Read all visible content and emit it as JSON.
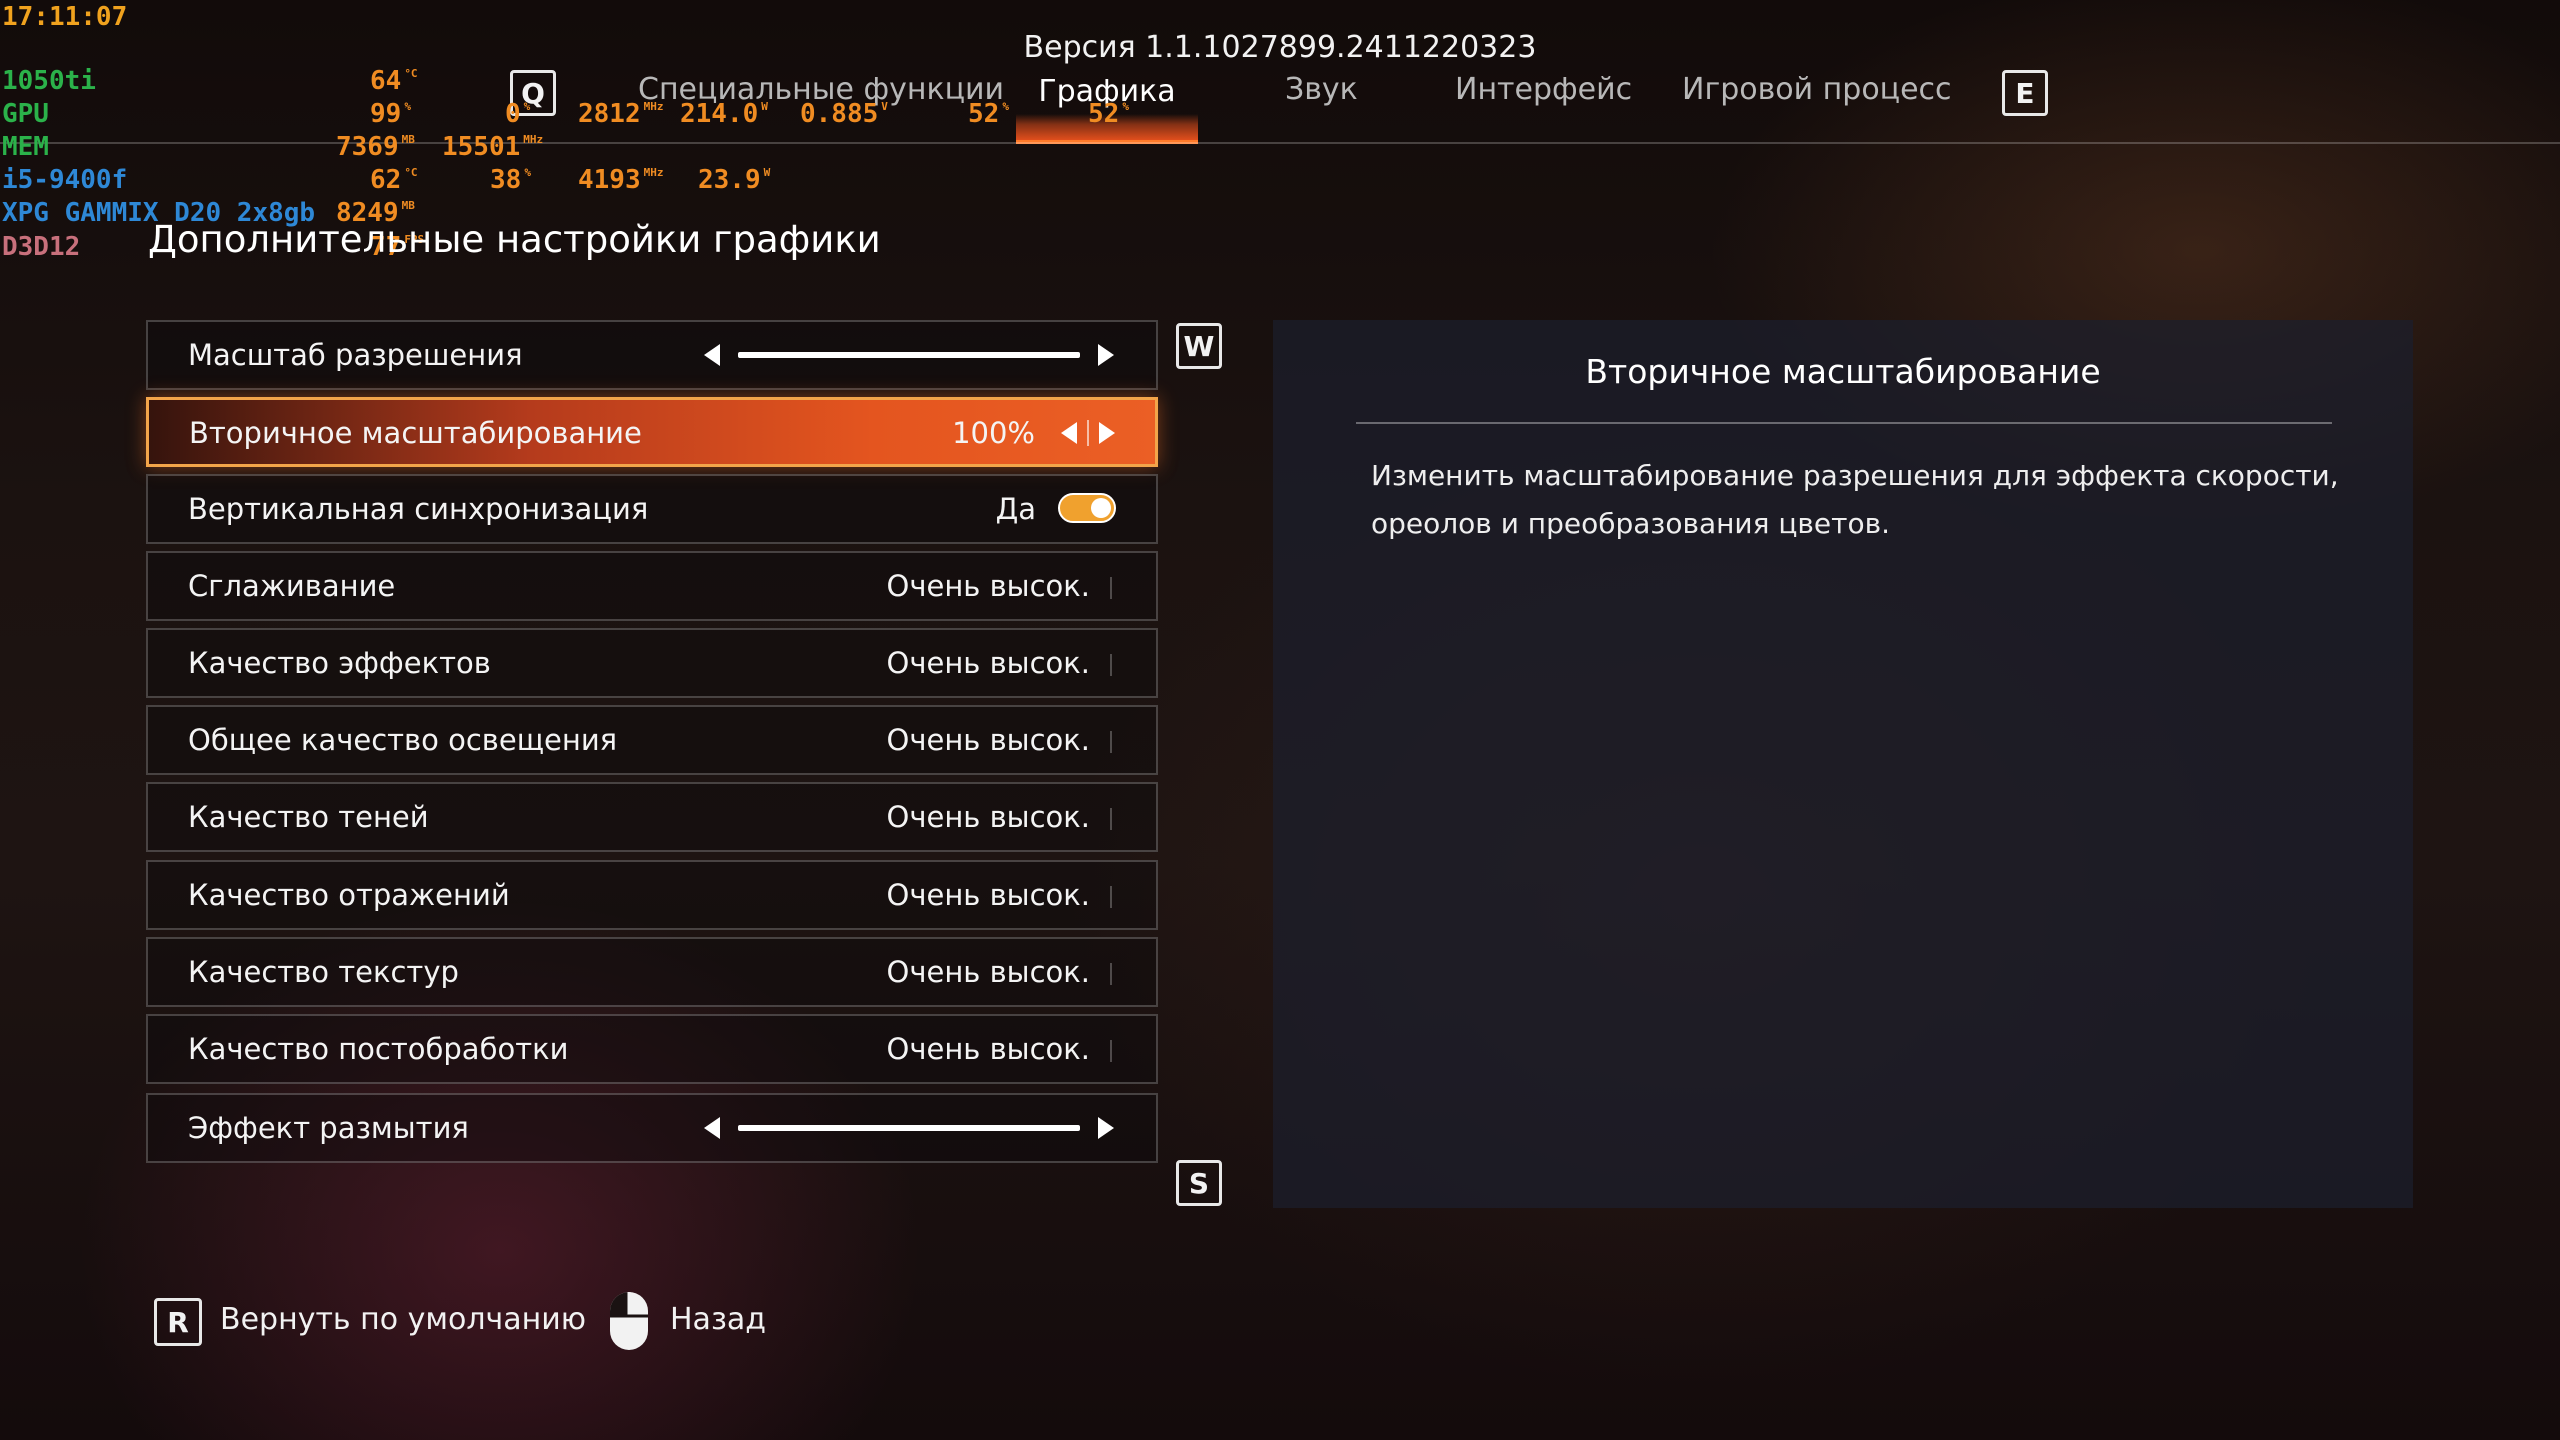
{
  "header": {
    "version": "Версия 1.1.1027899.2411220323",
    "prev_key": "Q",
    "next_key": "E",
    "tabs": [
      {
        "label": "Специальные функции"
      },
      {
        "label": "Графика",
        "active": true
      },
      {
        "label": "Звук"
      },
      {
        "label": "Интерфейс"
      },
      {
        "label": "Игровой процесс"
      }
    ]
  },
  "osd": {
    "time": "17:11:07",
    "gpu_name": "1050ti",
    "gpu_temp": "64",
    "gpu_temp_unit": "°C",
    "gpu_label": "GPU",
    "gpu_load": "99",
    "gpu_load_unit": "%",
    "gpu_extra": "0",
    "gpu_extra_unit": "%",
    "gpu_clock": "2812",
    "gpu_clock_unit": "MHz",
    "gpu_power": "214.0",
    "gpu_power_unit": "W",
    "gpu_voltage": "0.885",
    "gpu_voltage_unit": "V",
    "gpu_fan": "52",
    "gpu_fan_unit": "%",
    "gpu_fan2": "52",
    "gpu_fan2_unit": "%",
    "mem_label": "MEM",
    "mem_used": "7369",
    "mem_used_unit": "MB",
    "mem_clock": "15501",
    "mem_clock_unit": "MHz",
    "cpu_name": "i5-9400f",
    "cpu_temp": "62",
    "cpu_temp_unit": "°C",
    "cpu_load": "38",
    "cpu_load_unit": "%",
    "cpu_clock": "4193",
    "cpu_clock_unit": "MHz",
    "cpu_power": "23.9",
    "cpu_power_unit": "W",
    "ram_name": "XPG GAMMIX D20 2x8gb",
    "ram_used": "8249",
    "ram_used_unit": "MB",
    "api": "D3D12",
    "fps": "77",
    "fps_unit": "FPS"
  },
  "section_title": "Дополнительные настройки графики",
  "nav_keys": {
    "up": "W",
    "down": "S"
  },
  "settings": [
    {
      "label": "Масштаб разрешения",
      "control": "slider"
    },
    {
      "label": "Вторичное масштабирование",
      "value": "100%",
      "control": "arrows",
      "active": true
    },
    {
      "label": "Вертикальная синхронизация",
      "value": "Да",
      "control": "toggle",
      "on": true
    },
    {
      "label": "Сглаживание",
      "value": "Очень высок."
    },
    {
      "label": "Качество эффектов",
      "value": "Очень высок."
    },
    {
      "label": "Общее качество освещения",
      "value": "Очень высок."
    },
    {
      "label": "Качество теней",
      "value": "Очень высок."
    },
    {
      "label": "Качество отражений",
      "value": "Очень высок."
    },
    {
      "label": "Качество текстур",
      "value": "Очень высок."
    },
    {
      "label": "Качество постобработки",
      "value": "Очень высок."
    },
    {
      "label": "Эффект размытия",
      "control": "slider"
    }
  ],
  "info": {
    "title": "Вторичное масштабирование",
    "description": "Изменить масштабирование разрешения для эффекта скорости, ореолов и преобразования цветов."
  },
  "footer": {
    "reset_key": "R",
    "reset_label": "Вернуть по умолчанию",
    "back_label": "Назад"
  },
  "colors": {
    "accent": "#e4551f",
    "accent_border": "#f3a54a",
    "toggle_on": "#f0a12e"
  }
}
